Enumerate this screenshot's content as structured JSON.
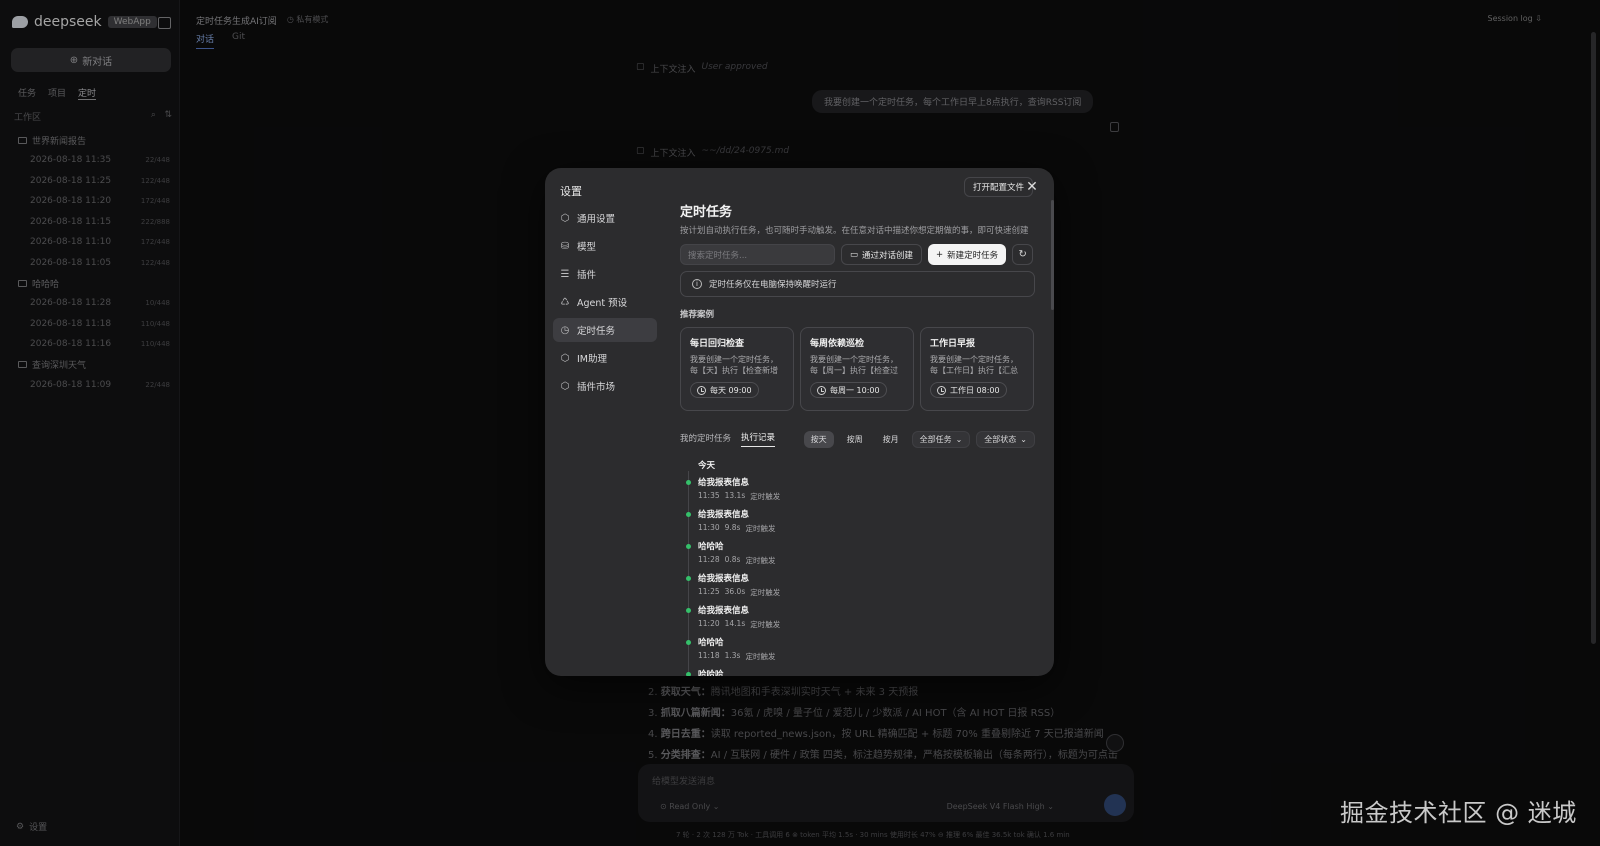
{
  "app": {
    "logo_text": "deepseek",
    "logo_badge": "WebApp",
    "new_chat": "新对话",
    "sidebar_tabs": [
      "任务",
      "项目",
      "定时"
    ],
    "workspace_label": "工作区",
    "groups": [
      {
        "name": "世界新闻报告",
        "items": [
          {
            "date": "2026-08-18 11:35",
            "size": "22/448"
          },
          {
            "date": "2026-08-18 11:25",
            "size": "122/448"
          },
          {
            "date": "2026-08-18 11:20",
            "size": "172/448"
          },
          {
            "date": "2026-08-18 11:15",
            "size": "222/888"
          },
          {
            "date": "2026-08-18 11:10",
            "size": "172/448"
          },
          {
            "date": "2026-08-18 11:05",
            "size": "122/448"
          }
        ]
      },
      {
        "name": "哈哈哈",
        "items": [
          {
            "date": "2026-08-18 11:28",
            "size": "10/448"
          },
          {
            "date": "2026-08-18 11:18",
            "size": "110/448"
          },
          {
            "date": "2026-08-18 11:16",
            "size": "110/448"
          }
        ]
      },
      {
        "name": "查询深圳天气",
        "items": [
          {
            "date": "2026-08-18 11:09",
            "size": "22/448"
          }
        ]
      }
    ],
    "settings_label": "设置",
    "chat_title": "定时任务生成AI订阅",
    "chat_title_sub": "◷ 私有模式",
    "chat_tabs": [
      "对话",
      "Git"
    ],
    "session_log": "Session log ⇩",
    "ctx1": "上下文注入",
    "ctx1_dim": "User approved",
    "ctx2": "上下文注入",
    "ctx2_dim": "~~/dd/24-0975.md",
    "user_bubble": "我要创建一个定时任务，每个工作日早上8点执行，查询RSS订阅",
    "bg_list": [
      {
        "n": "2.",
        "b": "获取天气：",
        "t": "腾讯地图和手表深圳实时天气 + 未来 3 天预报"
      },
      {
        "n": "3.",
        "b": "抓取八篇新闻：",
        "t": "36氪 / 虎嗅 / 量子位 / 爱范儿 / 少数派 / AI HOT（含 AI HOT 日报 RSS）"
      },
      {
        "n": "4.",
        "b": "跨日去重：",
        "t": "读取 reported_news.json，按 URL 精确匹配 + 标题 70% 重叠剔除近 7 天已报道新闻"
      },
      {
        "n": "5.",
        "b": "分类排查：",
        "t": "AI / 互联网 / 硬件 / 政策 四类，标注趋势规律，严格按模板输出（每条两行），标题为可点击"
      }
    ],
    "input_placeholder": "给模型发送消息",
    "read_only": "⊙ Read Only ⌄",
    "model": "DeepSeek V4 Flash  High ⌄",
    "footer": "7 轮 · 2 次   128 万 Tok · 工具调用 6   ⊗ token 平均 1.5s · 30 mins   使用时长 47%   ⊖ 推理 6%   最佳 36.5k tok   确认 1.6 min",
    "watermark": "掘金技术社区 @ 迷城"
  },
  "modal": {
    "title": "设置",
    "open_config": "打开配置文件",
    "nav": [
      {
        "label": "通用设置",
        "icon": "gear-icon",
        "glyph": "⬡"
      },
      {
        "label": "模型",
        "icon": "database-icon",
        "glyph": "⛁"
      },
      {
        "label": "插件",
        "icon": "sliders-icon",
        "glyph": "☰"
      },
      {
        "label": "Agent 预设",
        "icon": "recycle-icon",
        "glyph": "♺"
      },
      {
        "label": "定时任务",
        "icon": "clock-icon",
        "glyph": "◷"
      },
      {
        "label": "IM助理",
        "icon": "chat-hex-icon",
        "glyph": "⬡"
      },
      {
        "label": "插件市场",
        "icon": "store-icon",
        "glyph": "⬡"
      }
    ],
    "active_nav": 4,
    "heading": "定时任务",
    "description": "按计划自动执行任务，也可随时手动触发。在任意对话中描述你想定期做的事，即可快速创建",
    "search_placeholder": "搜索定时任务...",
    "create_via_chat": "通过对话创建",
    "new_task": "新建定时任务",
    "notice": "定时任务仅在电脑保持唤醒时运行",
    "recommended_label": "推荐案例",
    "cards": [
      {
        "title": "每日回归检查",
        "desc": "我要创建一个定时任务，每【天】执行【检查新增测...",
        "schedule": "每天 09:00"
      },
      {
        "title": "每周依赖巡检",
        "desc": "我要创建一个定时任务，每【周一】执行【检查过期...",
        "schedule": "每周一 10:00"
      },
      {
        "title": "工作日早报",
        "desc": "我要创建一个定时任务，每【工作日】执行【汇总昨...",
        "schedule": "工作日 08:00"
      }
    ],
    "tabs": [
      "我的定时任务",
      "执行记录"
    ],
    "active_tab": 1,
    "filters": [
      "按天",
      "按周",
      "按月"
    ],
    "active_filter": 0,
    "select_task": "全部任务",
    "select_status": "全部状态",
    "timeline_date": "今天",
    "records": [
      {
        "name": "给我报表信息",
        "time": "11:35",
        "duration": "13.1s",
        "trigger": "定时触发"
      },
      {
        "name": "给我报表信息",
        "time": "11:30",
        "duration": "9.8s",
        "trigger": "定时触发"
      },
      {
        "name": "哈哈哈",
        "time": "11:28",
        "duration": "0.8s",
        "trigger": "定时触发"
      },
      {
        "name": "给我报表信息",
        "time": "11:25",
        "duration": "36.0s",
        "trigger": "定时触发"
      },
      {
        "name": "给我报表信息",
        "time": "11:20",
        "duration": "14.1s",
        "trigger": "定时触发"
      },
      {
        "name": "哈哈哈",
        "time": "11:18",
        "duration": "1.3s",
        "trigger": "定时触发"
      },
      {
        "name": "哈哈哈",
        "time": "",
        "duration": "",
        "trigger": ""
      }
    ],
    "status_color": "#35c06a"
  }
}
